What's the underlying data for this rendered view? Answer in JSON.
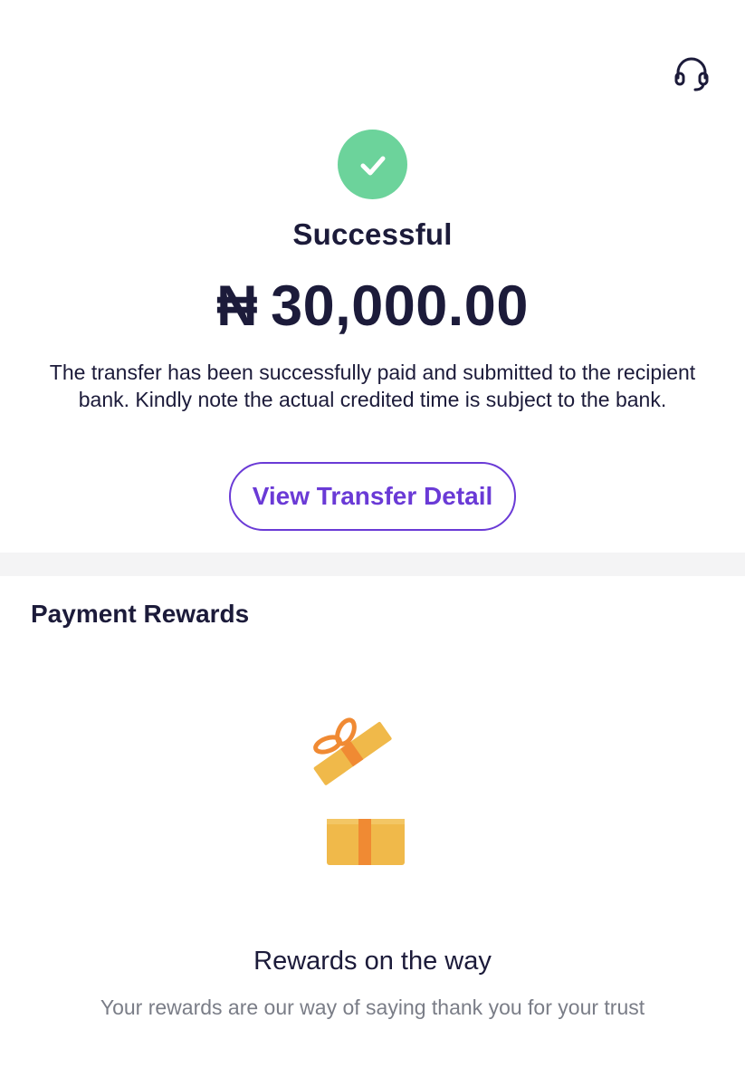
{
  "header": {
    "support_icon": "headset-icon"
  },
  "status": {
    "icon": "check-icon",
    "title": "Successful",
    "currency_symbol": "₦",
    "amount": "30,000.00",
    "message": "The transfer has been successfully paid and submitted to the recipient bank. Kindly note the actual credited time is subject to the bank.",
    "detail_button_label": "View Transfer Detail"
  },
  "rewards": {
    "heading": "Payment Rewards",
    "illustration": "gift-box-icon",
    "title": "Rewards on the way",
    "subtitle": "Your rewards are our way of saying thank you for your trust"
  },
  "colors": {
    "success_green": "#6cd39b",
    "accent_purple": "#6a3ad6",
    "text_dark": "#1c1b3a",
    "text_muted": "#7a7d87",
    "gift_yellow": "#f0b94a",
    "ribbon_orange": "#f08a33"
  }
}
